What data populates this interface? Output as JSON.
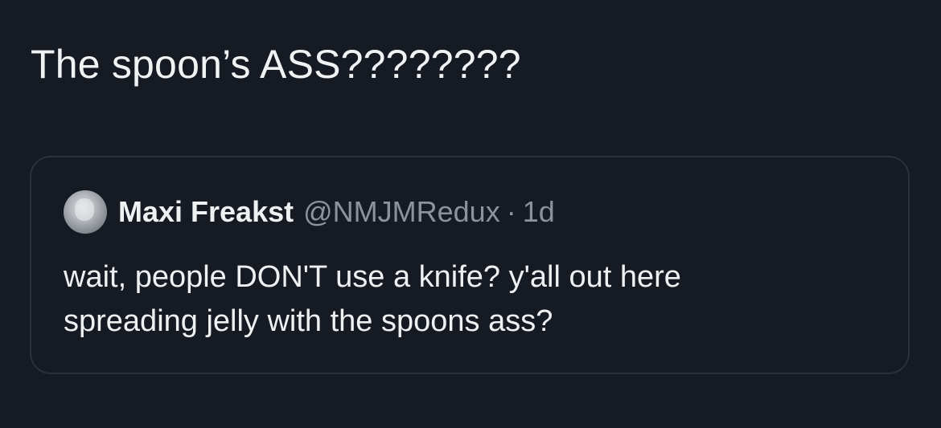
{
  "tweet": {
    "text": "The spoon’s ASS????????"
  },
  "quote": {
    "author_name": "Maxi Freakst",
    "handle": "@NMJMRedux",
    "separator": "·",
    "age": "1d",
    "avatar_icon": "user-avatar-icon",
    "lines": [
      "wait, people DON'T use a knife? y'all out here",
      "spreading jelly with the spoons ass?"
    ]
  },
  "colors": {
    "background": "#151a23",
    "text": "#e7e9ea",
    "secondary_text": "#8b949e",
    "card_border": "#2b313c"
  }
}
